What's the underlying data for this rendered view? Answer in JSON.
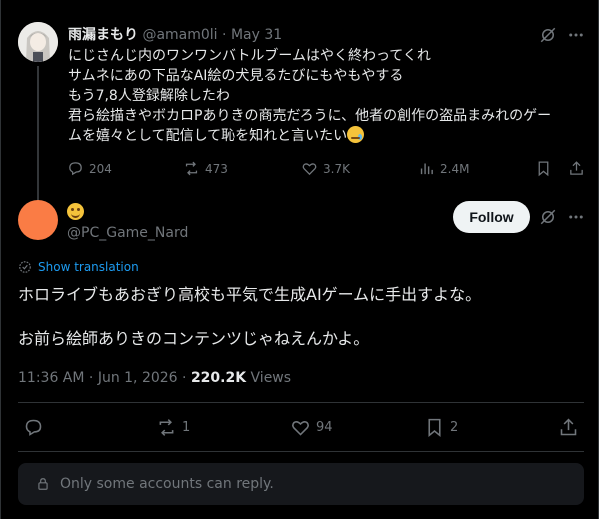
{
  "parent_tweet": {
    "display_name": "雨漏まもり",
    "handle": "@amam0li",
    "separator": "·",
    "date": "May 31",
    "lines": [
      "にじさんじ内のワンワンバトルブームはやく終わってくれ",
      "サムネにあの下品なAI絵の犬見るたびにもやもやする",
      "もう7,8人登録解除したわ",
      "君ら絵描きやボカロPありきの商売だろうに、他者の創作の盗品まみれのゲー",
      "ムを嬉々として配信して恥を知れと言いたい"
    ],
    "emoji": "crying-face-emoji",
    "replies": "204",
    "reposts": "473",
    "likes": "3.7K",
    "views": "2.4M"
  },
  "main_tweet": {
    "handle": "@PC_Game_Nard",
    "follow_label": "Follow",
    "show_translation": "Show translation",
    "lines": [
      "ホロライブもあおぎり高校も平気で生成AIゲームに手出すよな。",
      "",
      "お前ら絵師ありきのコンテンツじゃねえんかよ。"
    ],
    "time": "11:36 AM",
    "separator": "·",
    "date": "Jun 1, 2026",
    "views_count": "220.2K",
    "views_label": "Views",
    "replies": "",
    "reposts": "1",
    "likes": "94",
    "bookmarks": "2"
  },
  "reply_restriction": "Only some accounts can reply.",
  "colors": {
    "background": "#000000",
    "text": "#e7e9ea",
    "muted": "#71767b",
    "link": "#1d9bf0",
    "avatar_orange": "#fa7c45"
  }
}
